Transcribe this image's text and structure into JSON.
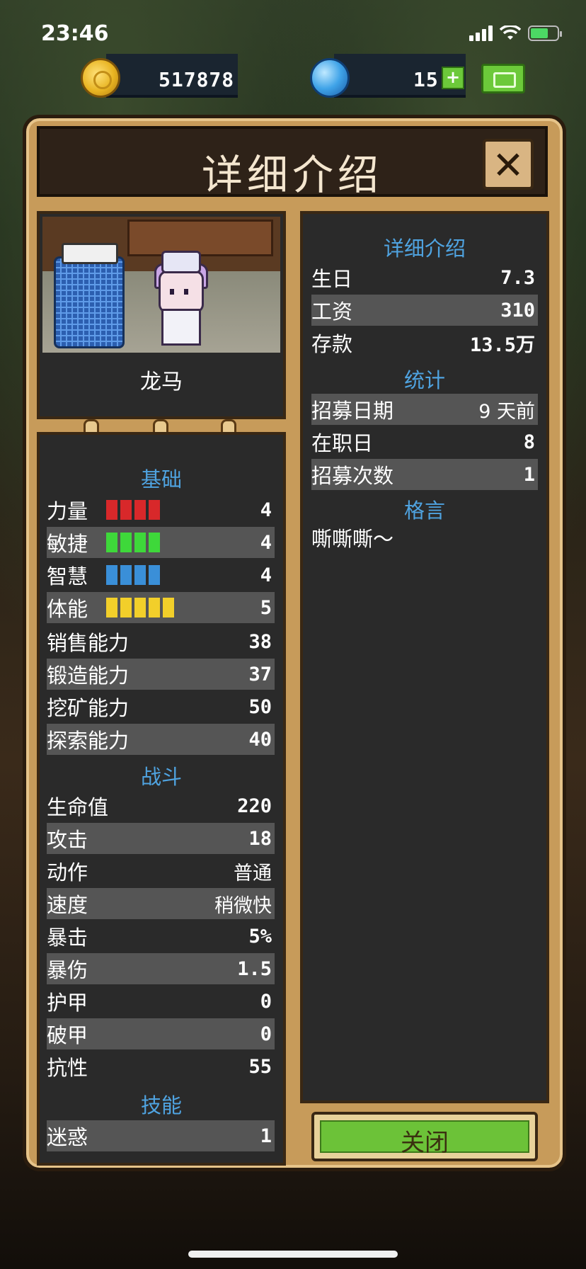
{
  "status_bar": {
    "time": "23:46"
  },
  "currency": {
    "coins": "517878",
    "gems": "15",
    "plus_label": "+"
  },
  "dialog": {
    "title": "详细介绍",
    "close_x": "✕"
  },
  "character": {
    "name": "龙马"
  },
  "basics": {
    "heading": "基础",
    "attributes": [
      {
        "label": "力量",
        "value": "4",
        "pips": 4,
        "color": "#d8282a"
      },
      {
        "label": "敏捷",
        "value": "4",
        "pips": 4,
        "color": "#3ed83a"
      },
      {
        "label": "智慧",
        "value": "4",
        "pips": 4,
        "color": "#3a8fd8"
      },
      {
        "label": "体能",
        "value": "5",
        "pips": 5,
        "color": "#f2cf2a"
      }
    ],
    "abilities": [
      {
        "label": "销售能力",
        "value": "38"
      },
      {
        "label": "锻造能力",
        "value": "37"
      },
      {
        "label": "挖矿能力",
        "value": "50"
      },
      {
        "label": "探索能力",
        "value": "40"
      }
    ]
  },
  "combat": {
    "heading": "战斗",
    "rows": [
      {
        "label": "生命值",
        "value": "220"
      },
      {
        "label": "攻击",
        "value": "18"
      },
      {
        "label": "动作",
        "value": "普通"
      },
      {
        "label": "速度",
        "value": "稍微快"
      },
      {
        "label": "暴击",
        "value": "5%"
      },
      {
        "label": "暴伤",
        "value": "1.5"
      },
      {
        "label": "护甲",
        "value": "0"
      },
      {
        "label": "破甲",
        "value": "0"
      },
      {
        "label": "抗性",
        "value": "55"
      }
    ]
  },
  "skills": {
    "heading": "技能",
    "rows": [
      {
        "label": "迷惑",
        "value": "1"
      }
    ]
  },
  "details": {
    "heading": "详细介绍",
    "rows": [
      {
        "label": "生日",
        "value": "7.3"
      },
      {
        "label": "工资",
        "value": "310"
      },
      {
        "label": "存款",
        "value": "13.5万"
      }
    ]
  },
  "stats": {
    "heading": "统计",
    "rows": [
      {
        "label": "招募日期",
        "value": "9 天前"
      },
      {
        "label": "在职日",
        "value": "8"
      },
      {
        "label": "招募次数",
        "value": "1"
      }
    ]
  },
  "motto": {
    "heading": "格言",
    "text": "嘶嘶嘶～"
  },
  "close_button": {
    "label": "关闭"
  },
  "colors": {
    "accent_blue": "#4fa3e0",
    "button_green": "#6cc238",
    "panel_tan": "#c79b5a"
  }
}
